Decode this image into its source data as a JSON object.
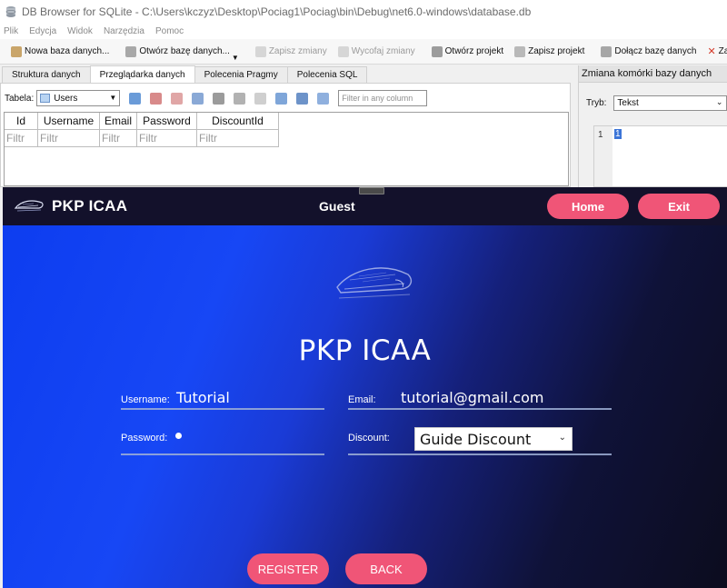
{
  "dbbrowser": {
    "window_title": "DB Browser for SQLite - C:\\Users\\kczyz\\Desktop\\Pociag1\\Pociag\\bin\\Debug\\net6.0-windows\\database.db",
    "menu": [
      "Plik",
      "Edycja",
      "Widok",
      "Narzędzia",
      "Pomoc"
    ],
    "toolbar": {
      "new_db": "Nowa baza danych...",
      "open_db": "Otwórz bazę danych...",
      "save_changes": "Zapisz zmiany",
      "revert_changes": "Wycofaj zmiany",
      "open_project": "Otwórz projekt",
      "save_project": "Zapisz projekt",
      "attach_db": "Dołącz bazę danych",
      "close_partial": "Za"
    },
    "tabs": [
      "Struktura danych",
      "Przeglądarka danych",
      "Polecenia Pragmy",
      "Polecenia SQL"
    ],
    "table_label": "Tabela:",
    "table_name": "Users",
    "filter_any_placeholder": "Filter in any column",
    "columns": [
      "Id",
      "Username",
      "Email",
      "Password",
      "DiscountId"
    ],
    "filter_placeholder": "Filtr",
    "side_panel": {
      "title": "Zmiana komórki bazy danych",
      "mode_label": "Tryb:",
      "mode_value": "Tekst",
      "line_number": "1",
      "cell_value": "1"
    }
  },
  "app": {
    "title": "PKP ICAA",
    "current_user": "Guest",
    "home_label": "Home",
    "exit_label": "Exit",
    "heading": "PKP ICAA",
    "form": {
      "username_label": "Username:",
      "username_value": "Tutorial",
      "email_label": "Email:",
      "email_value": "tutorial@gmail.com",
      "password_label": "Password:",
      "discount_label": "Discount:",
      "discount_value": "Guide Discount"
    },
    "register_label": "REGISTER",
    "back_label": "BACK"
  },
  "colors": {
    "accent_pink": "#f05577",
    "header_bg": "#13112b",
    "body_blue": "#1747f5"
  }
}
